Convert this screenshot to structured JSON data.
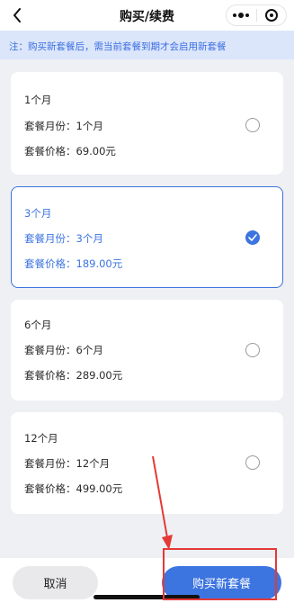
{
  "nav": {
    "title": "购买/续费"
  },
  "notice": {
    "text": "注：购买新套餐后，需当前套餐到期才会启用新套餐"
  },
  "plans": [
    {
      "name": "1个月",
      "months": "套餐月份：1个月",
      "price": "套餐价格：69.00元",
      "selected": false
    },
    {
      "name": "3个月",
      "months": "套餐月份：3个月",
      "price": "套餐价格：189.00元",
      "selected": true
    },
    {
      "name": "6个月",
      "months": "套餐月份：6个月",
      "price": "套餐价格：289.00元",
      "selected": false
    },
    {
      "name": "12个月",
      "months": "套餐月份：12个月",
      "price": "套餐价格：499.00元",
      "selected": false
    }
  ],
  "footer": {
    "cancel_label": "取消",
    "buy_label": "购买新套餐"
  },
  "colors": {
    "accent": "#3c74e0",
    "notice_bg": "#dce6fb",
    "annotation": "#e53935",
    "page_bg": "#eef0f4"
  },
  "icons": {
    "back": "chevron-left-icon",
    "more": "more-dots-icon",
    "close": "target-circle-icon",
    "check": "check-icon"
  }
}
